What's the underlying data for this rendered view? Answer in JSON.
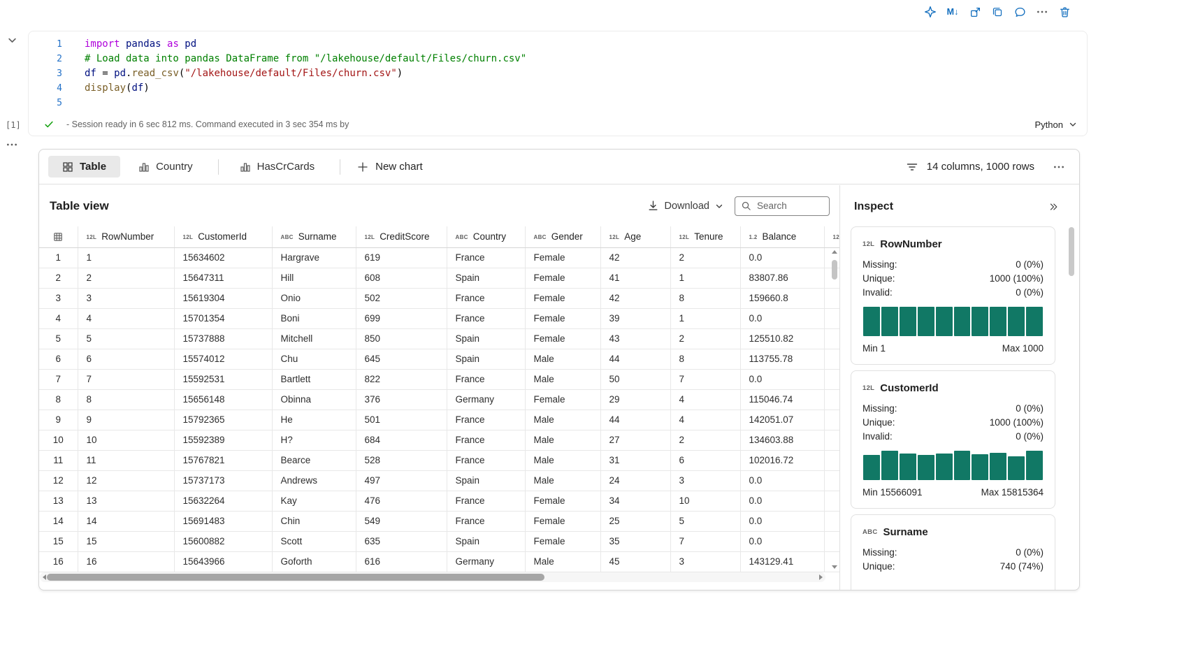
{
  "colors": {
    "toolbar_icon": "#0f6cbd",
    "histogram_bar": "#117865",
    "success_check": "#13a10e"
  },
  "cell_toolbar": {
    "icons": [
      "copilot-icon",
      "markdown-icon",
      "open-in-window-icon",
      "duplicate-cell-icon",
      "comment-icon",
      "more-actions-icon",
      "delete-cell-icon"
    ]
  },
  "code_cell": {
    "execution_count": "[1]",
    "language": "Python",
    "status_text": "- Session ready in 6 sec 812 ms. Command executed in 3 sec 354 ms by",
    "lines": [
      {
        "n": "1",
        "tokens": [
          {
            "c": "kw",
            "t": "import"
          },
          {
            "c": "var",
            "t": " pandas "
          },
          {
            "c": "kw",
            "t": "as"
          },
          {
            "c": "var",
            "t": " pd"
          }
        ]
      },
      {
        "n": "2",
        "tokens": [
          {
            "c": "com",
            "t": "# Load data into pandas DataFrame from \"/lakehouse/default/Files/churn.csv\""
          }
        ]
      },
      {
        "n": "3",
        "tokens": [
          {
            "c": "var",
            "t": "df"
          },
          {
            "c": "pl",
            "t": " = "
          },
          {
            "c": "var",
            "t": "pd"
          },
          {
            "c": "pl",
            "t": "."
          },
          {
            "c": "fn",
            "t": "read_csv"
          },
          {
            "c": "pl",
            "t": "("
          },
          {
            "c": "str",
            "t": "\"/lakehouse/default/Files/churn.csv\""
          },
          {
            "c": "pl",
            "t": ")"
          }
        ]
      },
      {
        "n": "4",
        "tokens": [
          {
            "c": "fn",
            "t": "display"
          },
          {
            "c": "pl",
            "t": "("
          },
          {
            "c": "var",
            "t": "df"
          },
          {
            "c": "pl",
            "t": ")"
          }
        ]
      },
      {
        "n": "5",
        "tokens": []
      }
    ]
  },
  "results": {
    "tabs": [
      {
        "label": "Table",
        "icon": "table-grid-icon",
        "selected": true
      },
      {
        "label": "Country",
        "icon": "bar-chart-icon",
        "selected": false
      },
      {
        "label": "HasCrCards",
        "icon": "bar-chart-icon",
        "selected": false
      }
    ],
    "new_chart_label": "New chart",
    "summary_text": "14 columns, 1000 rows",
    "table_view": {
      "title": "Table view",
      "download_label": "Download",
      "search_placeholder": "Search",
      "columns": [
        {
          "type": "12L",
          "name": "RowNumber"
        },
        {
          "type": "12L",
          "name": "CustomerId"
        },
        {
          "type": "ABC",
          "name": "Surname"
        },
        {
          "type": "12L",
          "name": "CreditScore"
        },
        {
          "type": "ABC",
          "name": "Country"
        },
        {
          "type": "ABC",
          "name": "Gender"
        },
        {
          "type": "12L",
          "name": "Age"
        },
        {
          "type": "12L",
          "name": "Tenure"
        },
        {
          "type": "1.2",
          "name": "Balance"
        },
        {
          "type": "12L",
          "name": ""
        }
      ],
      "rows": [
        [
          "1",
          "1",
          "15634602",
          "Hargrave",
          "619",
          "France",
          "Female",
          "42",
          "2",
          "0.0",
          ""
        ],
        [
          "2",
          "2",
          "15647311",
          "Hill",
          "608",
          "Spain",
          "Female",
          "41",
          "1",
          "83807.86",
          ""
        ],
        [
          "3",
          "3",
          "15619304",
          "Onio",
          "502",
          "France",
          "Female",
          "42",
          "8",
          "159660.8",
          ""
        ],
        [
          "4",
          "4",
          "15701354",
          "Boni",
          "699",
          "France",
          "Female",
          "39",
          "1",
          "0.0",
          ""
        ],
        [
          "5",
          "5",
          "15737888",
          "Mitchell",
          "850",
          "Spain",
          "Female",
          "43",
          "2",
          "125510.82",
          ""
        ],
        [
          "6",
          "6",
          "15574012",
          "Chu",
          "645",
          "Spain",
          "Male",
          "44",
          "8",
          "113755.78",
          ""
        ],
        [
          "7",
          "7",
          "15592531",
          "Bartlett",
          "822",
          "France",
          "Male",
          "50",
          "7",
          "0.0",
          ""
        ],
        [
          "8",
          "8",
          "15656148",
          "Obinna",
          "376",
          "Germany",
          "Female",
          "29",
          "4",
          "115046.74",
          ""
        ],
        [
          "9",
          "9",
          "15792365",
          "He",
          "501",
          "France",
          "Male",
          "44",
          "4",
          "142051.07",
          ""
        ],
        [
          "10",
          "10",
          "15592389",
          "H?",
          "684",
          "France",
          "Male",
          "27",
          "2",
          "134603.88",
          ""
        ],
        [
          "11",
          "11",
          "15767821",
          "Bearce",
          "528",
          "France",
          "Male",
          "31",
          "6",
          "102016.72",
          ""
        ],
        [
          "12",
          "12",
          "15737173",
          "Andrews",
          "497",
          "Spain",
          "Male",
          "24",
          "3",
          "0.0",
          ""
        ],
        [
          "13",
          "13",
          "15632264",
          "Kay",
          "476",
          "France",
          "Female",
          "34",
          "10",
          "0.0",
          ""
        ],
        [
          "14",
          "14",
          "15691483",
          "Chin",
          "549",
          "France",
          "Female",
          "25",
          "5",
          "0.0",
          ""
        ],
        [
          "15",
          "15",
          "15600882",
          "Scott",
          "635",
          "Spain",
          "Female",
          "35",
          "7",
          "0.0",
          ""
        ],
        [
          "16",
          "16",
          "15643966",
          "Goforth",
          "616",
          "Germany",
          "Male",
          "45",
          "3",
          "143129.41",
          ""
        ]
      ]
    },
    "inspect": {
      "title": "Inspect",
      "cards": [
        {
          "type": "12L",
          "name": "RowNumber",
          "stats": [
            [
              "Missing:",
              "0 (0%)"
            ],
            [
              "Unique:",
              "1000 (100%)"
            ],
            [
              "Invalid:",
              "0 (0%)"
            ]
          ],
          "histogram": [
            1,
            1,
            1,
            1,
            1,
            1,
            1,
            1,
            1,
            1
          ],
          "min_label": "Min 1",
          "max_label": "Max 1000",
          "clipped": false
        },
        {
          "type": "12L",
          "name": "CustomerId",
          "stats": [
            [
              "Missing:",
              "0 (0%)"
            ],
            [
              "Unique:",
              "1000 (100%)"
            ],
            [
              "Invalid:",
              "0 (0%)"
            ]
          ],
          "histogram": [
            0.85,
            1,
            0.9,
            0.86,
            0.9,
            1,
            0.88,
            0.93,
            0.8,
            1
          ],
          "min_label": "Min 15566091",
          "max_label": "Max 15815364",
          "clipped": false
        },
        {
          "type": "ABC",
          "name": "Surname",
          "stats": [
            [
              "Missing:",
              "0 (0%)"
            ],
            [
              "Unique:",
              "740 (74%)"
            ]
          ],
          "histogram": null,
          "min_label": null,
          "max_label": null,
          "clipped": true
        }
      ]
    }
  }
}
